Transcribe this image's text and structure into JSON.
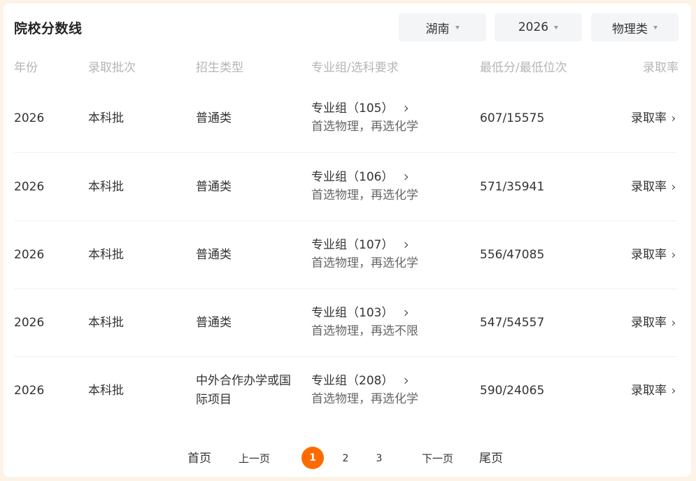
{
  "header": {
    "title": "院校分数线",
    "filters": {
      "province": "湖南",
      "year": "2026",
      "subject_type": "物理类"
    }
  },
  "table": {
    "columns": [
      "年份",
      "录取批次",
      "招生类型",
      "专业组/选科要求",
      "最低分/最低位次",
      "录取率"
    ],
    "rows": [
      {
        "year": "2026",
        "batch": "本科批",
        "type": "普通类",
        "group": "专业组（105）",
        "requirement": "首选物理，再选化学",
        "score_rank": "607/15575",
        "rate": "录取率"
      },
      {
        "year": "2026",
        "batch": "本科批",
        "type": "普通类",
        "group": "专业组（106）",
        "requirement": "首选物理，再选化学",
        "score_rank": "571/35941",
        "rate": "录取率"
      },
      {
        "year": "2026",
        "batch": "本科批",
        "type": "普通类",
        "group": "专业组（107）",
        "requirement": "首选物理，再选化学",
        "score_rank": "556/47085",
        "rate": "录取率"
      },
      {
        "year": "2026",
        "batch": "本科批",
        "type": "普通类",
        "group": "专业组（103）",
        "requirement": "首选物理，再选不限",
        "score_rank": "547/54557",
        "rate": "录取率"
      },
      {
        "year": "2026",
        "batch": "本科批",
        "type": "中外合作办学或国际项目",
        "group": "专业组（208）",
        "requirement": "首选物理，再选化学",
        "score_rank": "590/24065",
        "rate": "录取率"
      }
    ]
  },
  "pagination": {
    "first": "首页",
    "prev": "上一页",
    "pages": [
      "1",
      "2",
      "3"
    ],
    "current": "1",
    "next": "下一页",
    "last": "尾页"
  },
  "colors": {
    "accent": "#ff6a00",
    "background": "#fdf3e6",
    "header_text": "#b5b5b5"
  },
  "icons": {
    "dropdown": "caret-down-icon",
    "row_link": "chevron-right-icon"
  }
}
